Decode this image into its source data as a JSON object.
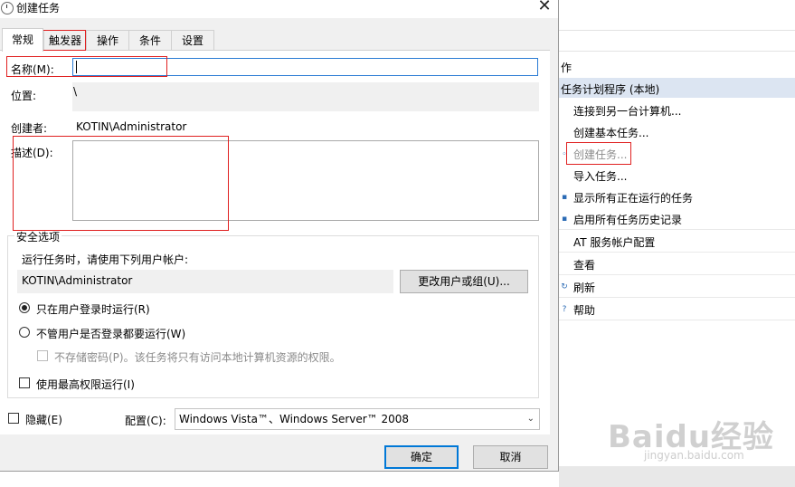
{
  "dialog": {
    "title": "创建任务",
    "close_glyph": "✕",
    "tabs": [
      {
        "label": "常规",
        "active": true
      },
      {
        "label": "触发器",
        "active": false
      },
      {
        "label": "操作",
        "active": false
      },
      {
        "label": "条件",
        "active": false
      },
      {
        "label": "设置",
        "active": false
      }
    ],
    "general": {
      "name_label": "名称(M):",
      "name_value": "",
      "location_label": "位置:",
      "location_value": "\\",
      "author_label": "创建者:",
      "author_value": "KOTIN\\Administrator",
      "description_label": "描述(D):",
      "description_value": ""
    },
    "security": {
      "group_title": "安全选项",
      "run_as_label": "运行任务时，请使用下列用户帐户:",
      "user_account": "KOTIN\\Administrator",
      "change_user_button": "更改用户或组(U)...",
      "radio_logged_on": {
        "label": "只在用户登录时运行(R)",
        "checked": true
      },
      "radio_whether_logged_on": {
        "label": "不管用户是否登录都要运行(W)",
        "checked": false
      },
      "no_store_password": {
        "label": "不存储密码(P)。该任务将只有访问本地计算机资源的权限。",
        "checked": false,
        "enabled": false
      },
      "highest_privileges": {
        "label": "使用最高权限运行(I)",
        "checked": false
      }
    },
    "hidden_label": "隐藏(E)",
    "configure_label": "配置(C):",
    "configure_value": "Windows Vista™、Windows Server™ 2008",
    "ok_button": "确定",
    "cancel_button": "取消"
  },
  "background_panel": {
    "header": "作",
    "section": "任务计划程序 (本地)",
    "actions": [
      {
        "label": "连接到另一台计算机...",
        "enabled": true
      },
      {
        "label": "创建基本任务...",
        "enabled": true
      },
      {
        "label": "创建任务...",
        "enabled": false
      },
      {
        "label": "导入任务...",
        "enabled": true
      },
      {
        "label": "显示所有正在运行的任务",
        "enabled": true
      },
      {
        "label": "启用所有任务历史记录",
        "enabled": true
      },
      {
        "label": "AT 服务帐户配置",
        "enabled": true
      },
      {
        "label": "查看",
        "enabled": true
      },
      {
        "label": "刷新",
        "enabled": true
      },
      {
        "label": "帮助",
        "enabled": true
      }
    ]
  },
  "watermark": {
    "main": "Baidu经验",
    "sub": "jingyan.baidu.com"
  },
  "colors": {
    "highlight": "#e02020",
    "focus_border": "#2a7bd4",
    "dialog_bg": "#f0f0f0",
    "section_bg": "#dce5f2"
  }
}
